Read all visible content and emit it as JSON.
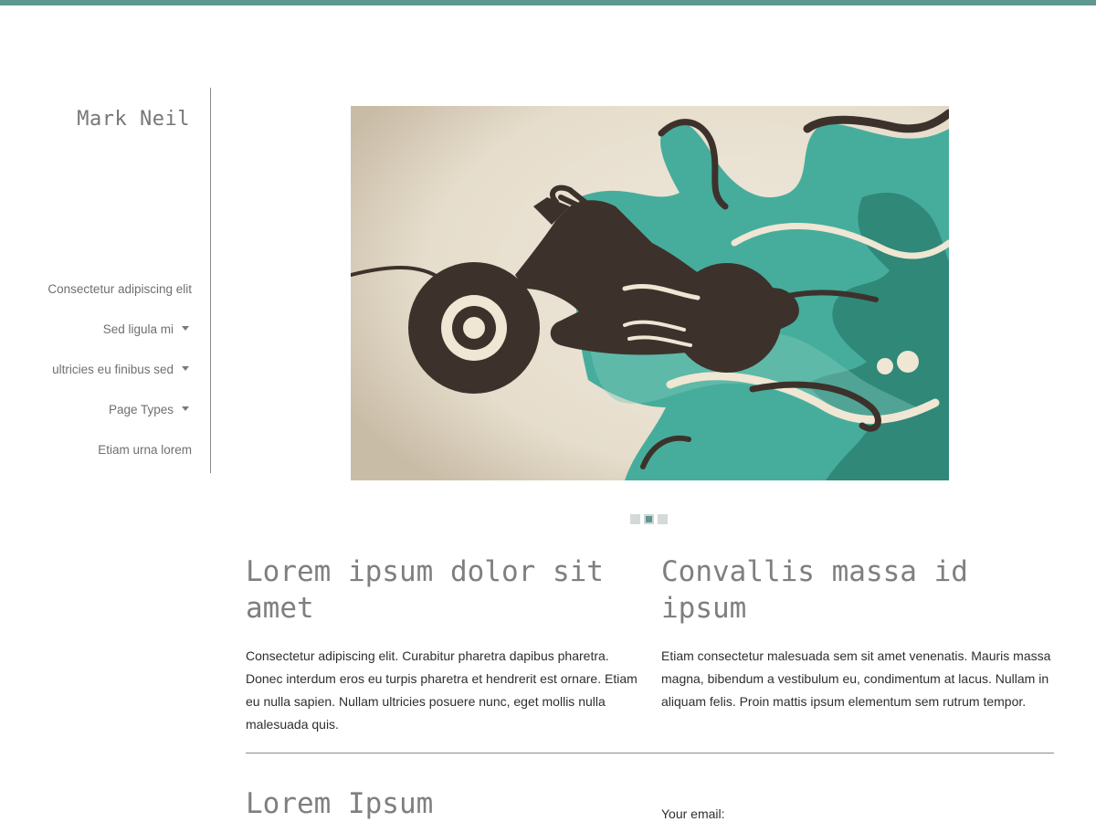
{
  "site": {
    "title": "Mark Neil"
  },
  "nav": {
    "items": [
      {
        "label": "Consectetur adipiscing elit",
        "has_dropdown": false
      },
      {
        "label": "Sed ligula mi",
        "has_dropdown": true
      },
      {
        "label": "ultricies eu finibus sed",
        "has_dropdown": true
      },
      {
        "label": "Page Types",
        "has_dropdown": true
      },
      {
        "label": "Etiam urna lorem",
        "has_dropdown": false
      }
    ]
  },
  "slider": {
    "image_subject": "motorcycle illustration with teal flames",
    "slide_count": 3,
    "active_slide": 2
  },
  "columns": [
    {
      "heading": "Lorem ipsum dolor sit amet",
      "body": "Consectetur adipiscing elit. Curabitur pharetra dapibus pharetra. Donec interdum eros eu turpis pharetra et hendrerit est ornare. Etiam eu nulla sapien. Nullam ultricies posuere nunc, eget mollis nulla malesuada quis."
    },
    {
      "heading": "Convallis massa id ipsum",
      "body": "Etiam consectetur malesuada sem sit amet venenatis. Mauris massa magna, bibendum a vestibulum eu, condimentum at lacus. Nullam in aliquam felis. Proin mattis ipsum elementum sem rutrum tempor."
    }
  ],
  "lower": {
    "heading": "Lorem Ipsum",
    "email_label": "Your email:"
  },
  "colors": {
    "accent": "#5f9890",
    "teal": "#46ad9c",
    "teal_dark": "#2f8878",
    "cream": "#ebe3d4",
    "motorbike": "#3d322b"
  }
}
